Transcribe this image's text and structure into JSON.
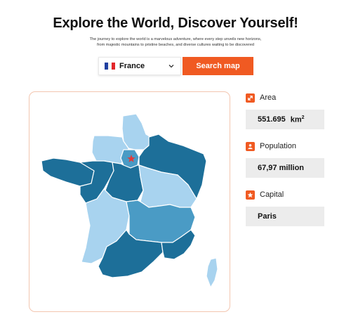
{
  "header": {
    "title": "Explore the World, Discover Yourself!",
    "subtitle_line1": "The journey to explore the world is a marvelous adventure, where every step unveils new horizons,",
    "subtitle_line2": "from majestic mountains to pristine beaches, and diverse cultures waiting to be discovered"
  },
  "search": {
    "country": "France",
    "country_flag": "french-flag-icon",
    "button_label": "Search map",
    "accent_color": "#f05a22"
  },
  "info": {
    "area": {
      "label": "Area",
      "value": "551.695",
      "unit": "km",
      "unit_exp": "2",
      "icon": "expand-arrow-icon"
    },
    "population": {
      "label": "Population",
      "value": "67,97 million",
      "icon": "person-icon"
    },
    "capital": {
      "label": "Capital",
      "value": "Paris",
      "icon": "star-icon"
    }
  },
  "map": {
    "capital_marker": "star-icon",
    "colors": {
      "light": "#a8d3ef",
      "mid": "#4a9bc5",
      "dark": "#1d6f99",
      "border": "#ffffff"
    }
  }
}
